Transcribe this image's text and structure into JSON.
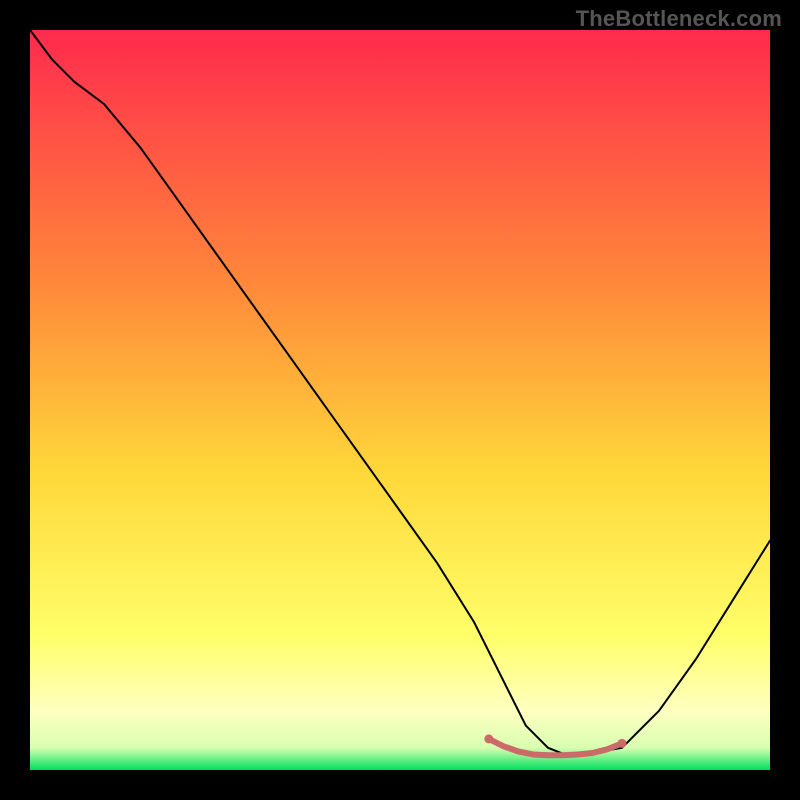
{
  "watermark": "TheBottleneck.com",
  "chart_data": {
    "type": "line",
    "title": "",
    "xlabel": "",
    "ylabel": "",
    "xlim": [
      0,
      100
    ],
    "ylim": [
      0,
      100
    ],
    "grid": false,
    "legend": false,
    "background_gradient": {
      "stops": [
        {
          "offset": 0.0,
          "color": "#ff2a4d"
        },
        {
          "offset": 0.35,
          "color": "#ff8a3a"
        },
        {
          "offset": 0.6,
          "color": "#ffd83a"
        },
        {
          "offset": 0.82,
          "color": "#ffff6a"
        },
        {
          "offset": 0.92,
          "color": "#ffffc0"
        },
        {
          "offset": 0.97,
          "color": "#d8ffb0"
        },
        {
          "offset": 1.0,
          "color": "#00e060"
        }
      ]
    },
    "series": [
      {
        "name": "bottleneck-curve",
        "color": "#000000",
        "width": 2,
        "x": [
          0,
          3,
          6,
          10,
          15,
          20,
          25,
          30,
          35,
          40,
          45,
          50,
          55,
          60,
          64,
          67,
          70,
          72,
          75,
          80,
          85,
          90,
          95,
          100
        ],
        "y": [
          100,
          96,
          93,
          90,
          84,
          77,
          70,
          63,
          56,
          49,
          42,
          35,
          28,
          20,
          12,
          6,
          3,
          2.2,
          2.1,
          3,
          8,
          15,
          23,
          31
        ]
      },
      {
        "name": "optimal-band",
        "color": "#cc6a6a",
        "width": 6,
        "x": [
          62,
          64,
          66,
          68,
          70,
          72,
          74,
          76,
          78,
          80
        ],
        "y": [
          4.2,
          3.2,
          2.5,
          2.1,
          2.0,
          2.0,
          2.1,
          2.3,
          2.8,
          3.6
        ]
      }
    ],
    "annotations": []
  }
}
